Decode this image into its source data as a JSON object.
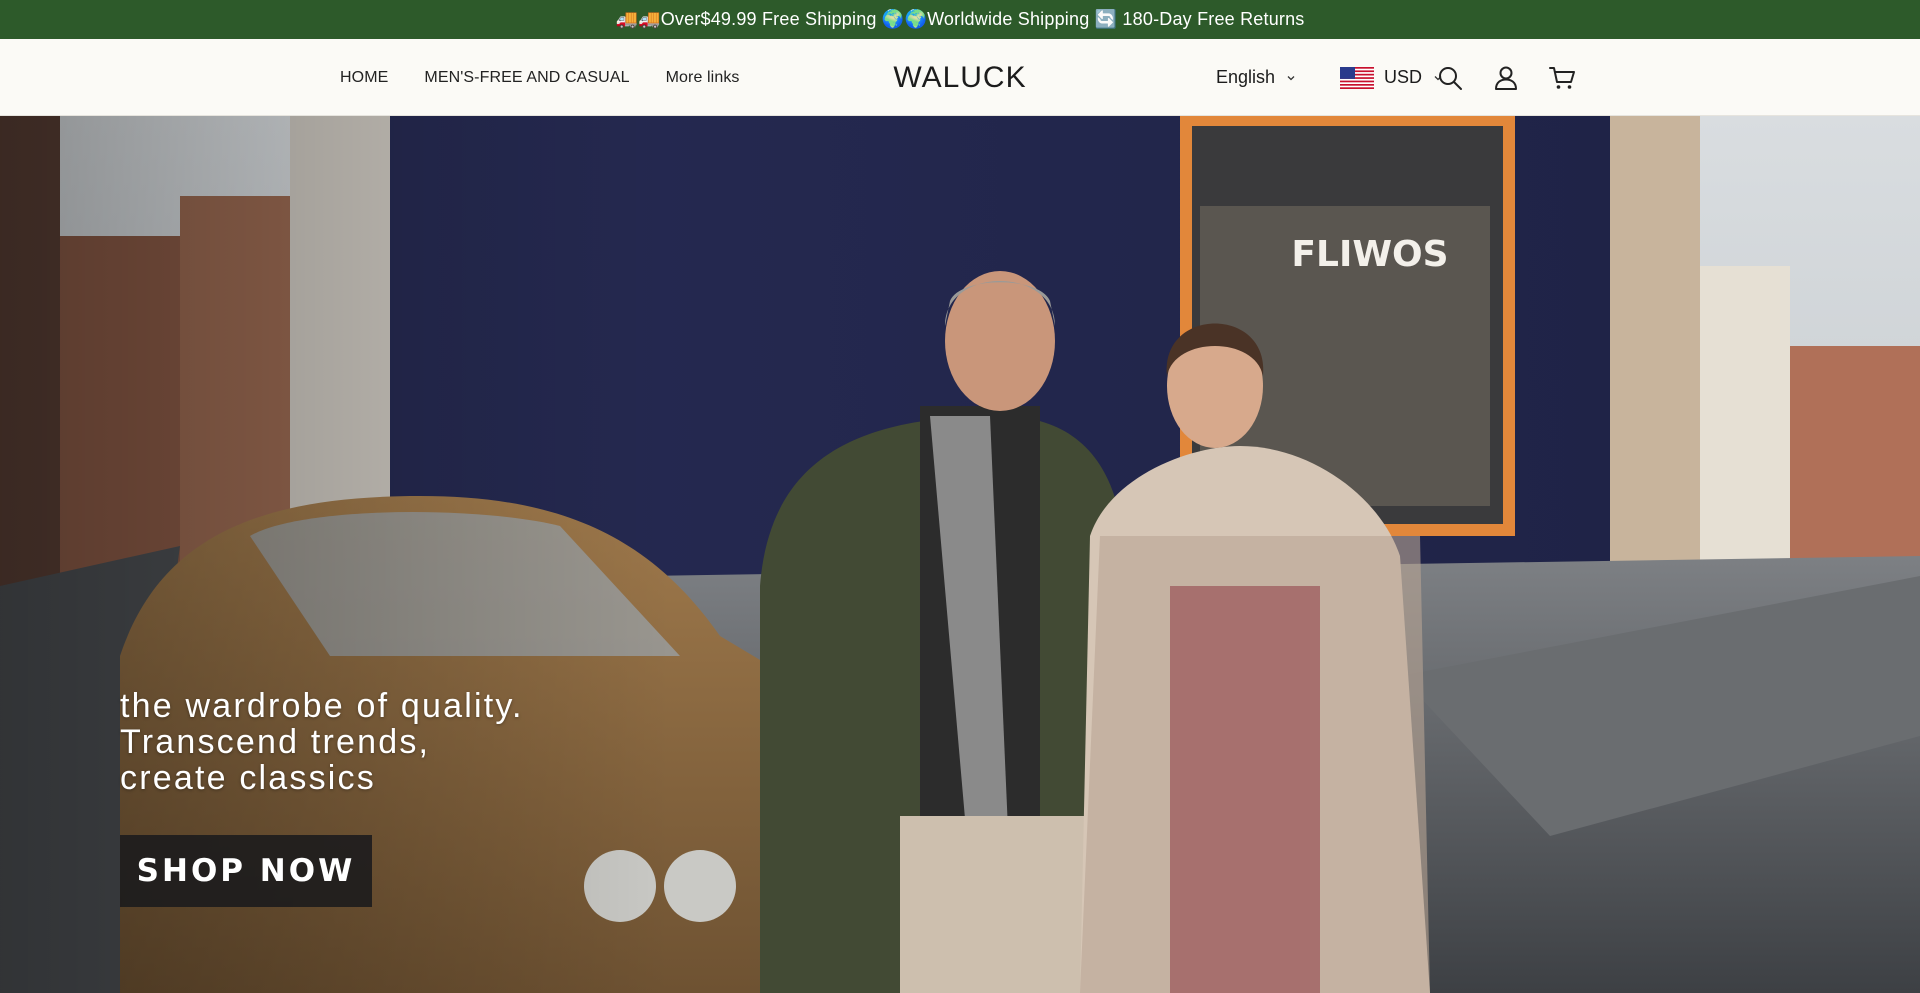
{
  "announcement": {
    "text": "🚚🚚Over$49.99 Free Shipping 🌍🌍Worldwide Shipping 🔄 180-Day Free Returns"
  },
  "nav": {
    "items": [
      {
        "label": "HOME"
      },
      {
        "label": "MEN'S-FREE AND CASUAL"
      },
      {
        "label": "More links"
      }
    ]
  },
  "logo": {
    "text": "WALUCK"
  },
  "language": {
    "selected": "English"
  },
  "currency": {
    "selected": "USD",
    "flag": "us-flag-icon"
  },
  "header_icons": [
    "search-icon",
    "account-icon",
    "cart-icon"
  ],
  "hero": {
    "lines": [
      "the wardrobe of quality.",
      "Transcend trends,",
      "create classics"
    ],
    "cta_label": "SHOP NOW"
  },
  "colors": {
    "announcement_bg": "#2d5a2a",
    "header_bg": "#fbfaf6",
    "cta_bg": "#1a1a1c"
  }
}
